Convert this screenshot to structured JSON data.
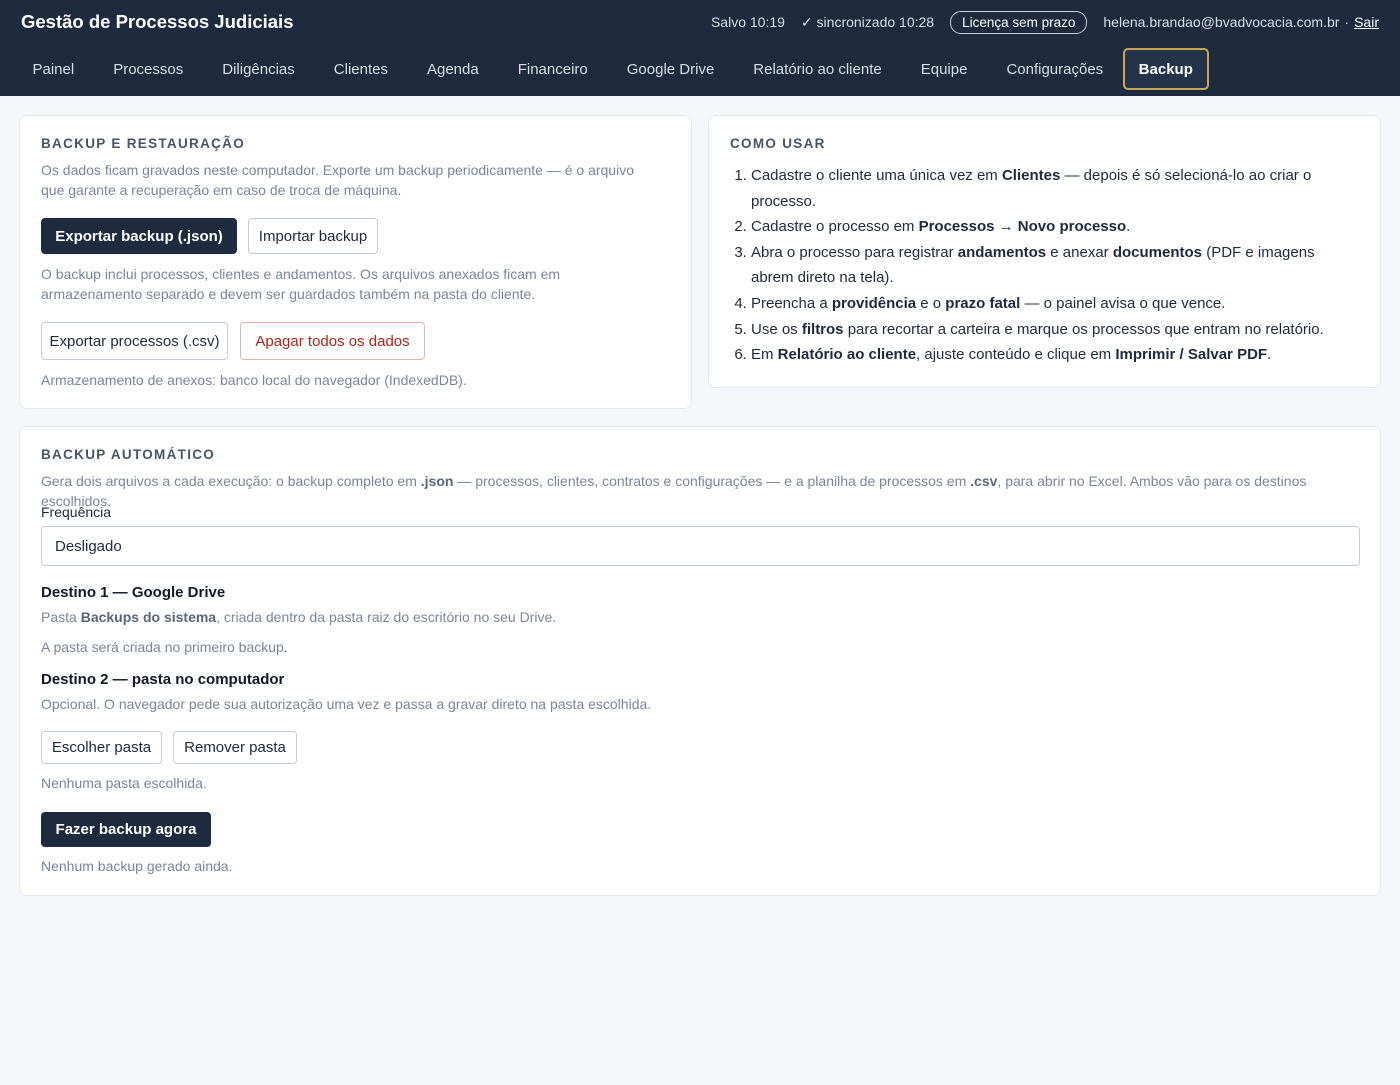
{
  "header": {
    "title": "Gestão de Processos Judiciais",
    "saved": "Salvo 10:19",
    "synced": "✓ sincronizado 10:28",
    "license": "Licença sem prazo",
    "user_email": "helena.brandao@bvadvocacia.com.br",
    "separator": "·",
    "logout": "Sair"
  },
  "nav": {
    "tabs": [
      {
        "label": "Painel"
      },
      {
        "label": "Processos"
      },
      {
        "label": "Diligências"
      },
      {
        "label": "Clientes"
      },
      {
        "label": "Agenda"
      },
      {
        "label": "Financeiro"
      },
      {
        "label": "Google Drive"
      },
      {
        "label": "Relatório ao cliente"
      },
      {
        "label": "Equipe"
      },
      {
        "label": "Configurações"
      },
      {
        "label": "Backup"
      }
    ],
    "active_tab": "Backup"
  },
  "backup_restore": {
    "title": "Backup e restauração",
    "description": "Os dados ficam gravados neste computador. Exporte um backup periodicamente — é o arquivo que garante a recuperação em caso de troca de máquina.",
    "export_json_label": "Exportar backup (.json)",
    "import_label": "Importar backup",
    "includes_note": "O backup inclui processos, clientes e andamentos. Os arquivos anexados ficam em armazenamento separado e devem ser guardados também na pasta do cliente.",
    "export_csv_label": "Exportar processos (.csv)",
    "delete_all_label": "Apagar todos os dados",
    "storage_note": "Armazenamento de anexos: banco local do navegador (IndexedDB)."
  },
  "how_to": {
    "title": "Como usar",
    "steps": [
      {
        "parts": [
          "Cadastre o cliente uma única vez em ",
          "Clientes",
          " — depois é só selecioná-lo ao criar o processo."
        ]
      },
      {
        "parts": [
          "Cadastre o processo em ",
          "Processos → Novo processo",
          "."
        ]
      },
      {
        "parts": [
          "Abra o processo para registrar ",
          "andamentos",
          " e anexar ",
          "documentos",
          " (PDF e imagens abrem direto na tela)."
        ]
      },
      {
        "parts": [
          "Preencha a ",
          "providência",
          " e o ",
          "prazo fatal",
          " — o painel avisa o que vence."
        ]
      },
      {
        "parts": [
          "Use os ",
          "filtros",
          " para recortar a carteira e marque os processos que entram no relatório."
        ]
      },
      {
        "parts": [
          "Em ",
          "Relatório ao cliente",
          ", ajuste conteúdo e clique em ",
          "Imprimir / Salvar PDF",
          "."
        ]
      }
    ]
  },
  "auto_backup": {
    "title": "Backup automático",
    "description_parts": [
      "Gera dois arquivos a cada execução: o backup completo em ",
      ".json",
      " — processos, clientes, contratos e configurações — e a planilha de processos em ",
      ".csv",
      ", para abrir no Excel. Ambos vão para os destinos escolhidos."
    ],
    "frequency_label": "Frequência",
    "frequency_value": "Desligado",
    "dest1_title": "Destino 1 — Google Drive",
    "dest1_desc_parts": [
      "Pasta ",
      "Backups do sistema",
      ", criada dentro da pasta raiz do escritório no seu Drive."
    ],
    "dest1_note": "A pasta será criada no primeiro backup.",
    "dest2_title": "Destino 2 — pasta no computador",
    "dest2_desc": "Opcional. O navegador pede sua autorização uma vez e passa a gravar direto na pasta escolhida.",
    "choose_folder_label": "Escolher pasta",
    "remove_folder_label": "Remover pasta",
    "folder_status": "Nenhuma pasta escolhida.",
    "backup_now_label": "Fazer backup agora",
    "backup_status": "Nenhum backup gerado ainda."
  }
}
